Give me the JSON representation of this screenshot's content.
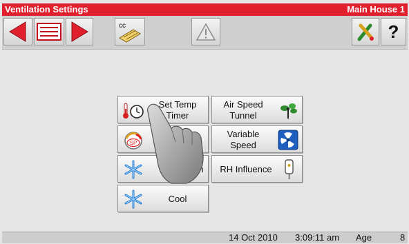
{
  "window": {
    "title": "Ventilation Settings",
    "location": "Main House 1"
  },
  "toolbar": {
    "buttons": [
      {
        "icon": "arrow-left-icon"
      },
      {
        "icon": "list-view-icon"
      },
      {
        "icon": "arrow-right-icon"
      },
      {
        "icon": "cc-keyboard-icon",
        "label": "cc"
      },
      {
        "icon": "warning-icon"
      },
      {
        "icon": "tools-icon"
      },
      {
        "icon": "help-icon",
        "label": "?"
      }
    ]
  },
  "menu": {
    "set_temp_timer": {
      "line1": "Set Temp",
      "line2": "Timer",
      "icon": "thermometer-clock-icon"
    },
    "air_speed_tunnel": {
      "line1": "Air Speed",
      "line2": "Tunnel",
      "icon": "air-speed-fan-icon"
    },
    "static_pressure": {
      "label_visible": "e",
      "icon": "pressure-gauge-icon",
      "gauge_text": "SP"
    },
    "variable_speed": {
      "line1": "Variable",
      "line2": "Speed",
      "icon": "fan-blades-icon"
    },
    "heat_influence": {
      "label_visible": "n",
      "icon": "snowflake-icon"
    },
    "rh_influence": {
      "label": "RH Influence",
      "icon": "humidity-sensor-icon"
    },
    "cool": {
      "label": "Cool",
      "icon": "snowflake-icon"
    }
  },
  "status": {
    "date": "14 Oct 2010",
    "time": "3:09:11 am",
    "age_label": "Age",
    "age_value": "8"
  },
  "colors": {
    "title_bar": "#e0202d",
    "arrow": "#e0202d",
    "panel": "#e6e6e6"
  }
}
